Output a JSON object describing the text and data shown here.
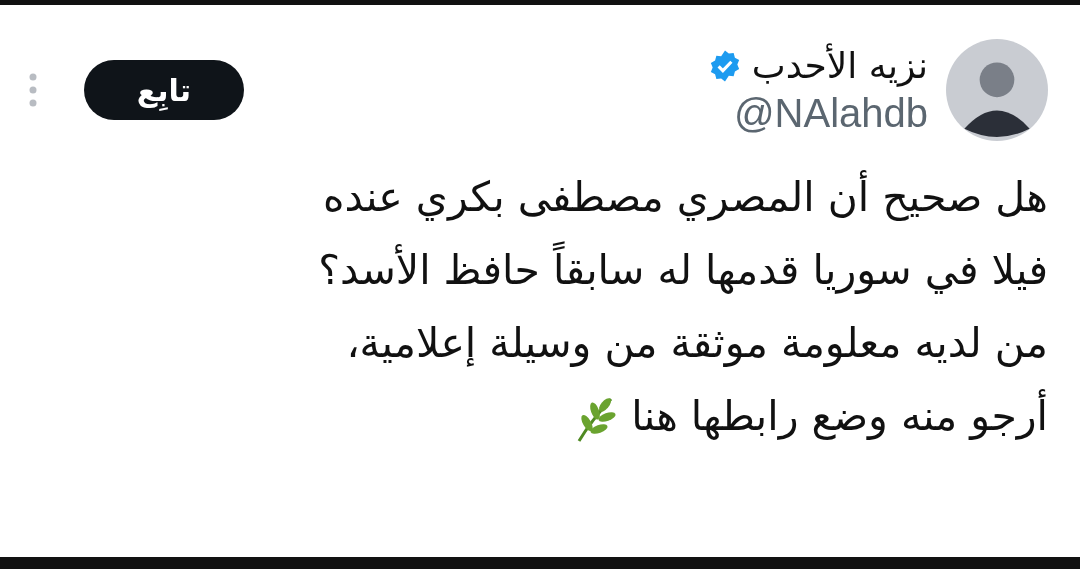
{
  "author": {
    "name": "نزيه الأحدب",
    "verified": true,
    "handle": "@NAlahdb"
  },
  "follow_button": {
    "label": "تابِع"
  },
  "tweet": {
    "text": "هل صحيح أن المصري مصطفى بكري عنده\nفيلا في سوريا قدمها له سابقاً حافظ الأسد؟\nمن لديه معلومة موثقة من وسيلة إعلامية،\nأرجو منه وضع رابطها هنا"
  }
}
